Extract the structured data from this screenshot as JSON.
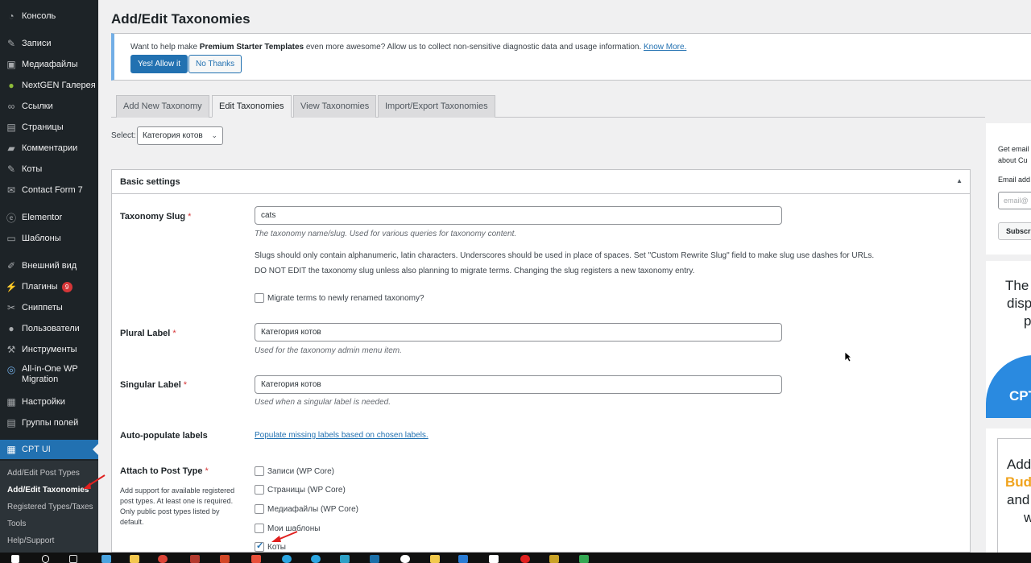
{
  "sidebar": {
    "items": [
      {
        "label": "Консоль",
        "icon": "dashboard-icon",
        "glyph": "◔"
      },
      {
        "label": "Записи",
        "icon": "pin-icon",
        "glyph": "✎"
      },
      {
        "label": "Медиафайлы",
        "icon": "media-icon",
        "glyph": "▣"
      },
      {
        "label": "NextGEN Галерея",
        "icon": "nextgen-icon",
        "glyph": "●"
      },
      {
        "label": "Ссылки",
        "icon": "link-icon",
        "glyph": "∞"
      },
      {
        "label": "Страницы",
        "icon": "pages-icon",
        "glyph": "▤"
      },
      {
        "label": "Комментарии",
        "icon": "comments-icon",
        "glyph": "▰"
      },
      {
        "label": "Коты",
        "icon": "pin-icon",
        "glyph": "✎"
      },
      {
        "label": "Contact Form 7",
        "icon": "mail-icon",
        "glyph": "✉"
      },
      {
        "label": "Elementor",
        "icon": "elementor-icon",
        "glyph": "ⓔ"
      },
      {
        "label": "Шаблоны",
        "icon": "folder-icon",
        "glyph": "▭"
      },
      {
        "label": "Внешний вид",
        "icon": "brush-icon",
        "glyph": "✐"
      },
      {
        "label": "Плагины",
        "icon": "plugin-icon",
        "glyph": "⚡",
        "badge": "9"
      },
      {
        "label": "Сниппеты",
        "icon": "scissors-icon",
        "glyph": "✂"
      },
      {
        "label": "Пользователи",
        "icon": "user-icon",
        "glyph": "●"
      },
      {
        "label": "Инструменты",
        "icon": "wrench-icon",
        "glyph": "⚒"
      },
      {
        "label": "All-in-One WP Migration",
        "icon": "migration-icon",
        "glyph": "◎"
      },
      {
        "label": "Настройки",
        "icon": "settings-icon",
        "glyph": "▦"
      },
      {
        "label": "Группы полей",
        "icon": "fields-icon",
        "glyph": "▤"
      },
      {
        "label": "CPT UI",
        "icon": "cptui-icon",
        "glyph": "▦"
      }
    ],
    "submenu": [
      {
        "label": "Add/Edit Post Types"
      },
      {
        "label": "Add/Edit Taxonomies"
      },
      {
        "label": "Registered Types/Taxes"
      },
      {
        "label": "Tools"
      },
      {
        "label": "Help/Support"
      }
    ]
  },
  "page": {
    "title": "Add/Edit Taxonomies"
  },
  "notice": {
    "text_before": "Want to help make ",
    "text_bold": "Premium Starter Templates",
    "text_after": " even more awesome? Allow us to collect non-sensitive diagnostic data and usage information. ",
    "link": "Know More.",
    "allow_button": "Yes! Allow it",
    "deny_button": "No Thanks"
  },
  "tabs": [
    "Add New Taxonomy",
    "Edit Taxonomies",
    "View Taxonomies",
    "Import/Export Taxonomies"
  ],
  "select": {
    "label": "Select:",
    "value": "Категория котов"
  },
  "basic_settings": {
    "title": "Basic settings",
    "taxonomy_slug": {
      "label": "Taxonomy Slug",
      "required": "*",
      "value": "cats",
      "desc": "The taxonomy name/slug. Used for various queries for taxonomy content.",
      "note1": "Slugs should only contain alphanumeric, latin characters. Underscores should be used in place of spaces. Set \"Custom Rewrite Slug\" field to make slug use dashes for URLs.",
      "note2": "DO NOT EDIT the taxonomy slug unless also planning to migrate terms. Changing the slug registers a new taxonomy entry.",
      "migrate_label": "Migrate terms to newly renamed taxonomy?"
    },
    "plural_label": {
      "label": "Plural Label",
      "required": "*",
      "value": "Категория котов",
      "desc": "Used for the taxonomy admin menu item."
    },
    "singular_label": {
      "label": "Singular Label",
      "required": "*",
      "value": "Категория котов",
      "desc": "Used when a singular label is needed."
    },
    "auto_populate": {
      "label": "Auto-populate labels",
      "link": "Populate missing labels based on chosen labels."
    },
    "attach_post_type": {
      "label": "Attach to Post Type",
      "required": "*",
      "help": "Add support for available registered post types. At least one is required. Only public post types listed by default.",
      "options": [
        {
          "label": "Записи (WP Core)",
          "checked": false
        },
        {
          "label": "Страницы (WP Core)",
          "checked": false
        },
        {
          "label": "Медиафайлы (WP Core)",
          "checked": false
        },
        {
          "label": "Мои шаблоны",
          "checked": false
        },
        {
          "label": "Коты",
          "checked": true
        }
      ]
    }
  },
  "right_column": {
    "box1": {
      "line1": "Get email",
      "line2": "about Cu",
      "label": "Email add",
      "placeholder": "email@",
      "button": "Subscr"
    },
    "box2": {
      "line1": "The",
      "line2": "disp",
      "line3": "p",
      "banner": "CPT"
    },
    "box3": {
      "line1": "Add",
      "line2": "Bud",
      "line3": "and",
      "line4": "w"
    }
  },
  "colors": {
    "accent": "#2271b1",
    "sidebar_bg": "#1d2327",
    "required": "#d63638",
    "arrow": "#e0201f"
  }
}
